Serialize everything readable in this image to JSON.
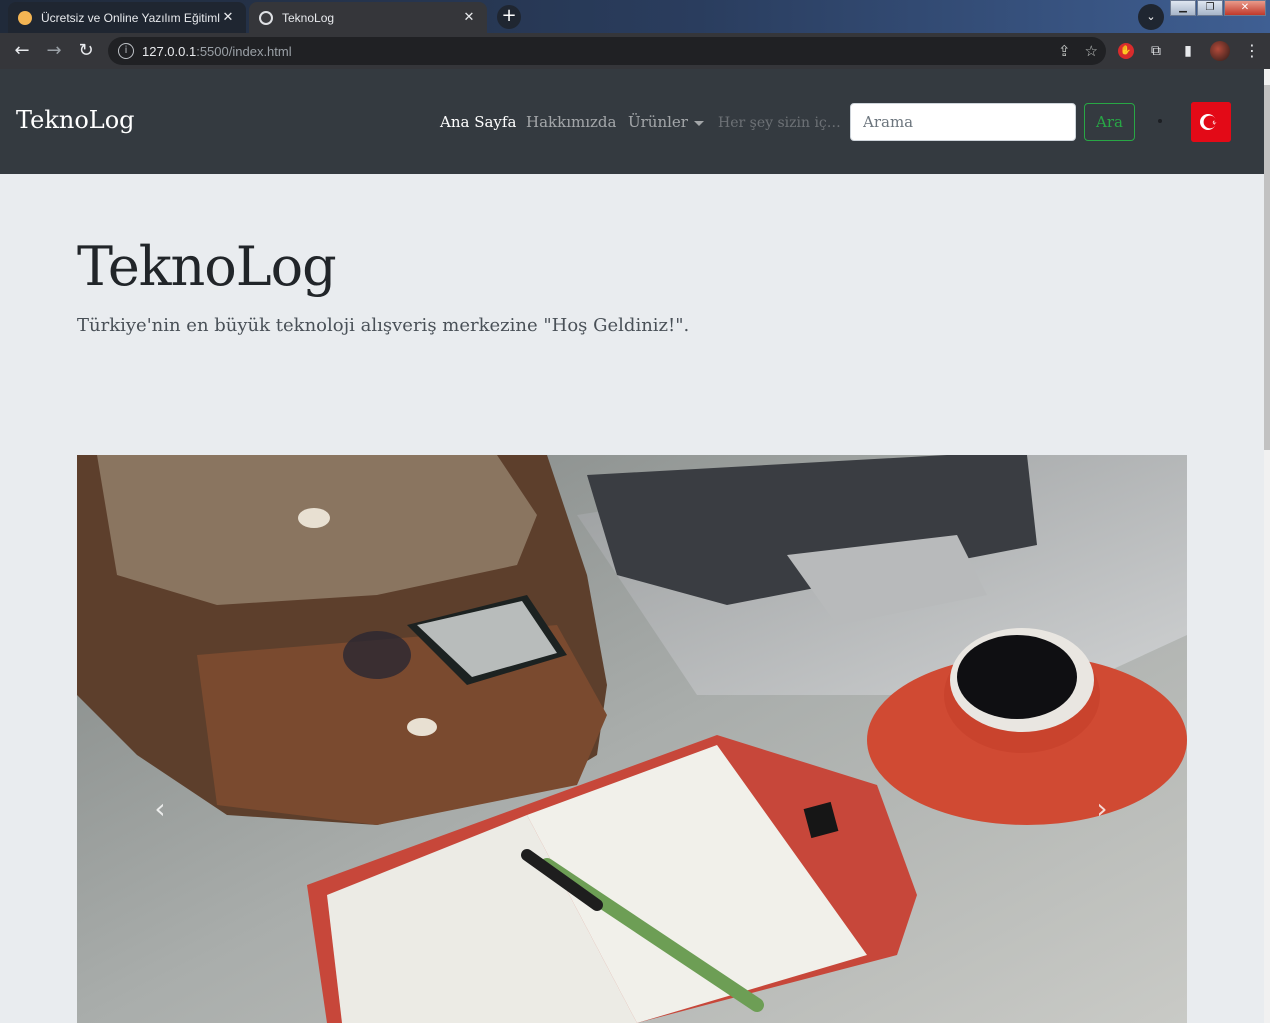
{
  "browser": {
    "tabs": [
      {
        "title": "Ücretsiz ve Online Yazılım Eğitimleri",
        "close": "✕"
      },
      {
        "title": "TeknoLog",
        "close": "✕"
      }
    ],
    "new_tab": "+",
    "tab_search": "⌄",
    "window_buttons": {
      "minimize": "▁",
      "maximize": "❐",
      "close": "✕"
    },
    "back": "←",
    "forward": "→",
    "reload": "↻",
    "info_icon": "i",
    "url_host": "127.0.0.1",
    "url_rest": ":5500/index.html",
    "share_icon": "⇪",
    "bookmark_icon": "☆",
    "extension_icons": {
      "adblock": "✋",
      "puzzle": "⧉",
      "sidepanel": "▮",
      "menu": "⋮"
    }
  },
  "navbar": {
    "brand": "TeknoLog",
    "links": [
      {
        "label": "Ana Sayfa",
        "active": true
      },
      {
        "label": "Hakkımızda",
        "active": false
      },
      {
        "label": "Ürünler",
        "active": false
      }
    ],
    "tagline": "Her şey sizin için...",
    "search_placeholder": "Arama",
    "search_button": "Ara",
    "flag_icon": "turkey-flag-icon"
  },
  "jumbotron": {
    "title": "TeknoLog",
    "lead": "Türkiye'nin en büyük teknoloji alışveriş merkezine \"Hoş Geldiniz!\"."
  },
  "carousel": {
    "prev": "‹",
    "next": "›"
  },
  "colors": {
    "navbar_bg": "#343a40",
    "page_bg": "#e9ecef",
    "search_btn": "#28a745",
    "flag_red": "#e30a17"
  }
}
